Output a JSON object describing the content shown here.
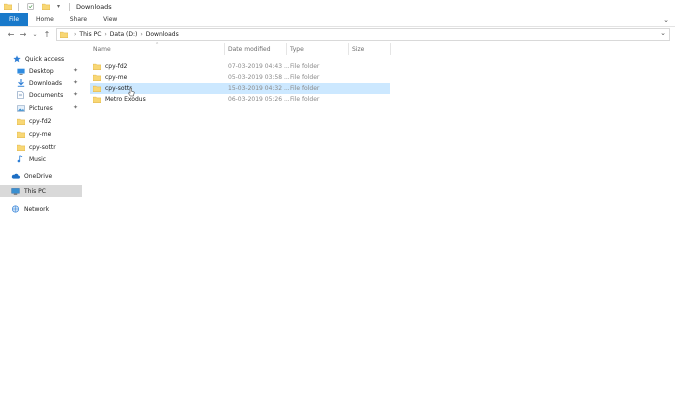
{
  "window": {
    "title": "Downloads"
  },
  "ribbon": {
    "tabs": [
      "File",
      "Home",
      "Share",
      "View"
    ]
  },
  "address": {
    "crumbs": [
      "This PC",
      "Data (D:)",
      "Downloads"
    ]
  },
  "nav": {
    "items": [
      {
        "label": "Quick access",
        "icon": "star-icon",
        "pinned": false
      },
      {
        "label": "Desktop",
        "icon": "desktop-icon",
        "pinned": true
      },
      {
        "label": "Downloads",
        "icon": "download-icon",
        "pinned": true
      },
      {
        "label": "Documents",
        "icon": "document-icon",
        "pinned": true
      },
      {
        "label": "Pictures",
        "icon": "picture-icon",
        "pinned": true
      },
      {
        "label": "cpy-fd2",
        "icon": "folder-icon",
        "pinned": false
      },
      {
        "label": "cpy-me",
        "icon": "folder-icon",
        "pinned": false
      },
      {
        "label": "cpy-sottr",
        "icon": "folder-icon",
        "pinned": false
      },
      {
        "label": "Music",
        "icon": "music-icon",
        "pinned": false
      },
      {
        "label": "OneDrive",
        "icon": "cloud-icon",
        "pinned": false
      },
      {
        "label": "This PC",
        "icon": "computer-icon",
        "pinned": false,
        "selected": true
      },
      {
        "label": "Network",
        "icon": "network-icon",
        "pinned": false
      }
    ]
  },
  "columns": {
    "name": "Name",
    "date": "Date modified",
    "type": "Type",
    "size": "Size"
  },
  "files": [
    {
      "name": "cpy-fd2",
      "date": "07-03-2019 04:43 ...",
      "type": "File folder"
    },
    {
      "name": "cpy-me",
      "date": "05-03-2019 03:58 ...",
      "type": "File folder"
    },
    {
      "name": "cpy-sottr",
      "date": "15-03-2019 04:32 ...",
      "type": "File folder",
      "selected": true
    },
    {
      "name": "Metro Exodus",
      "date": "06-03-2019 05:26 ...",
      "type": "File folder"
    }
  ],
  "colors": {
    "accent": "#1979ca",
    "selection": "#cce8ff",
    "folder": "#f8d775"
  }
}
